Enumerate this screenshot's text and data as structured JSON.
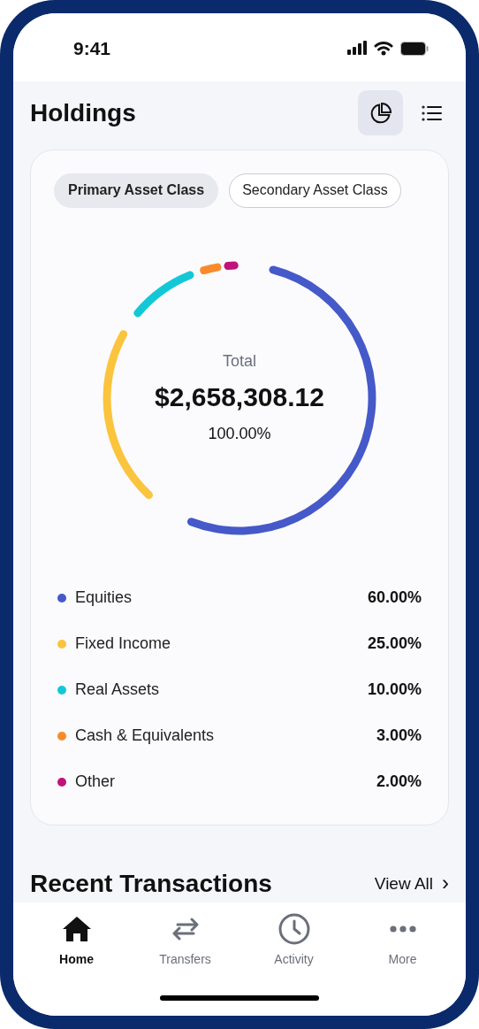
{
  "status_bar": {
    "time": "9:41"
  },
  "header": {
    "title": "Holdings",
    "views": [
      {
        "kind": "chart",
        "selected": true
      },
      {
        "kind": "list",
        "selected": false
      }
    ]
  },
  "filters": [
    {
      "label": "Primary Asset Class",
      "selected": true
    },
    {
      "label": "Secondary Asset Class",
      "selected": false
    }
  ],
  "summary": {
    "label": "Total",
    "amount": "$2,658,308.12",
    "percent": "100.00%"
  },
  "chart_data": {
    "type": "donut",
    "categories": [
      "Equities",
      "Fixed Income",
      "Real Assets",
      "Cash & Equivalents",
      "Other"
    ],
    "values": [
      60,
      25,
      10,
      3,
      2
    ]
  },
  "legend": [
    {
      "value": "60.00%",
      "color": "#4559c9"
    },
    {
      "value": "25.00%",
      "color": "#fbc43d"
    },
    {
      "value": "10.00%",
      "color": "#13c8d6"
    },
    {
      "value": "3.00%",
      "color": "#f98a2c"
    },
    {
      "value": "2.00%",
      "color": "#c0127a"
    }
  ],
  "recent": {
    "title": "Recent Transactions",
    "link": "View All",
    "chevron": "›"
  },
  "tab_bar": [
    {
      "label": "Home",
      "selected": true
    },
    {
      "label": "Transfers",
      "selected": false
    },
    {
      "label": "Activity",
      "selected": false
    },
    {
      "label": "More",
      "selected": false
    }
  ]
}
